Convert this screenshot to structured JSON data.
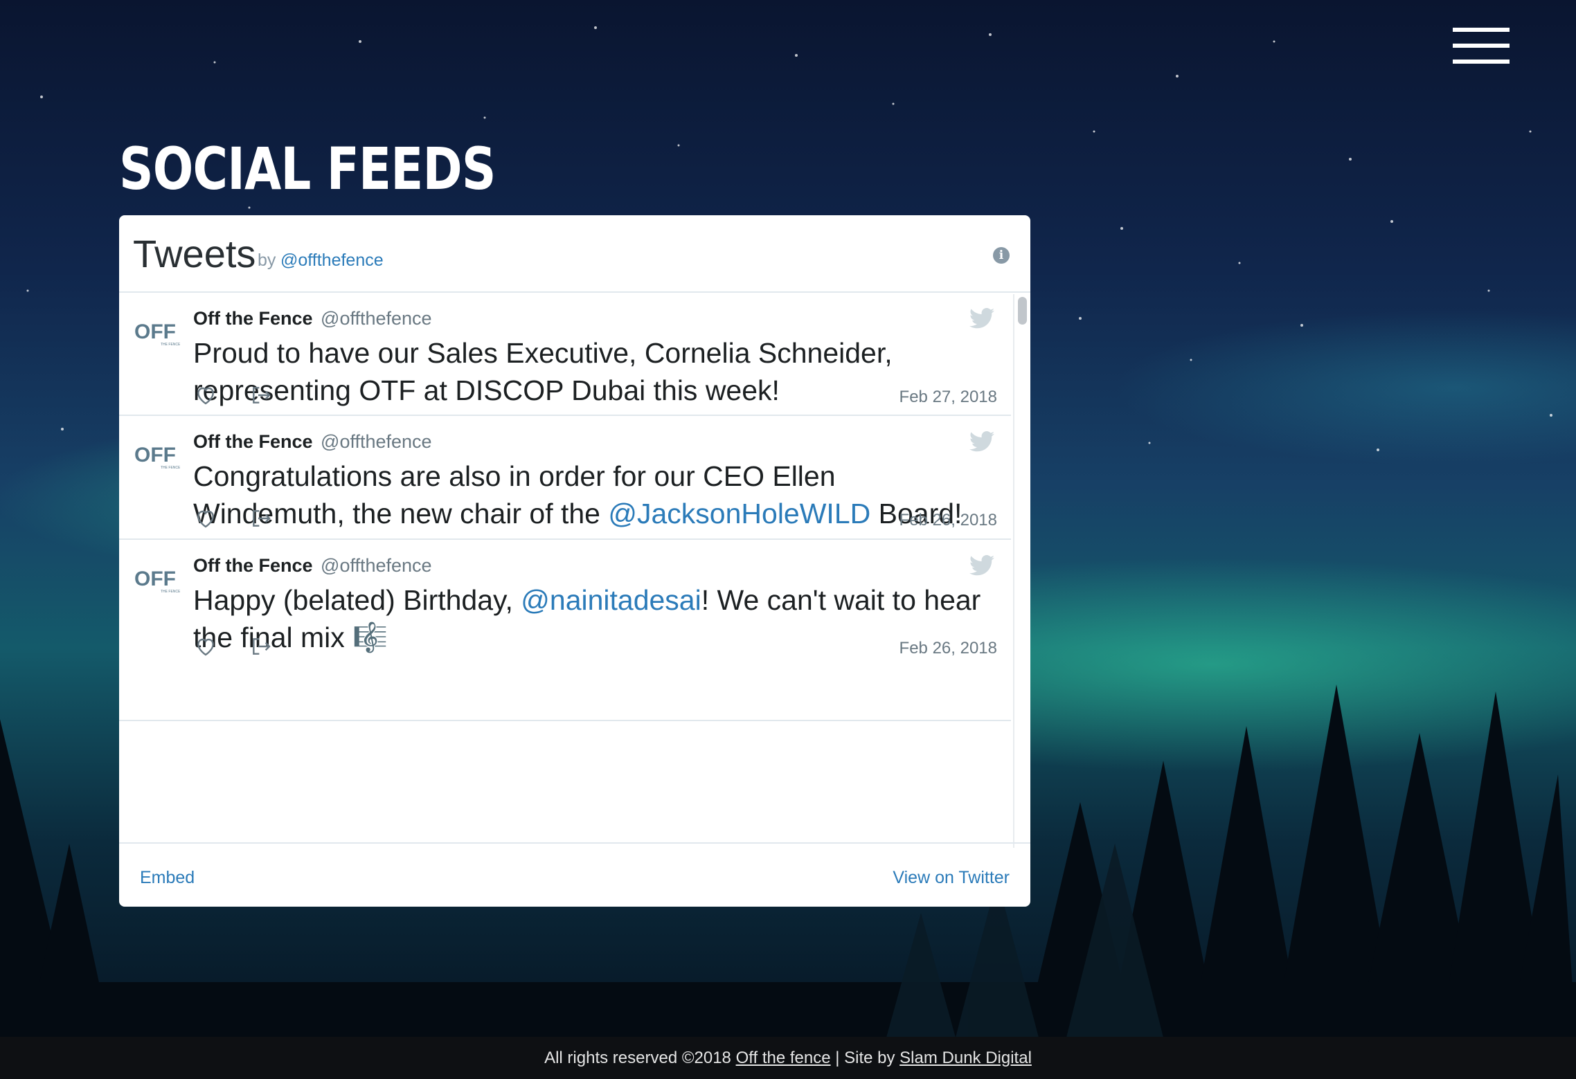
{
  "header": {
    "menu_icon": "hamburger-menu-icon",
    "page_title": "SOCIAL FEEDS"
  },
  "widget": {
    "title": "Tweets",
    "by_label": "by",
    "handle": "@offthefence",
    "info_icon": "info-icon",
    "tweets": [
      {
        "author_name": "Off the Fence",
        "author_handle": "@offthefence",
        "avatar_text": "OFF",
        "text_parts": [
          "Proud to have our Sales Executive, Cornelia Schneider, representing OTF at DISCOP Dubai this week!"
        ],
        "date": "Feb 27, 2018"
      },
      {
        "author_name": "Off the Fence",
        "author_handle": "@offthefence",
        "avatar_text": "OFF",
        "text_parts": [
          "Congratulations are also in order for our CEO Ellen Windemuth, the new chair of the ",
          "@JacksonHoleWILD",
          " Board!"
        ],
        "date": "Feb 26, 2018"
      },
      {
        "author_name": "Off the Fence",
        "author_handle": "@offthefence",
        "avatar_text": "OFF",
        "text_parts": [
          "Happy (belated) Birthday, ",
          "@nainitadesai",
          "! We can't wait to hear the final mix ",
          "🎼"
        ],
        "date": "Feb 26, 2018"
      }
    ],
    "footer": {
      "embed_label": "Embed",
      "view_label": "View on Twitter"
    }
  },
  "site_footer": {
    "prefix": "All rights reserved ©2018 ",
    "company_link": "Off the fence",
    "separator": " | Site by ",
    "agency_link": "Slam Dunk Digital"
  },
  "colors": {
    "link_blue": "#2b7bb9",
    "text_dark": "#1c2022",
    "text_muted": "#697882",
    "footer_bg": "#0e1013"
  }
}
